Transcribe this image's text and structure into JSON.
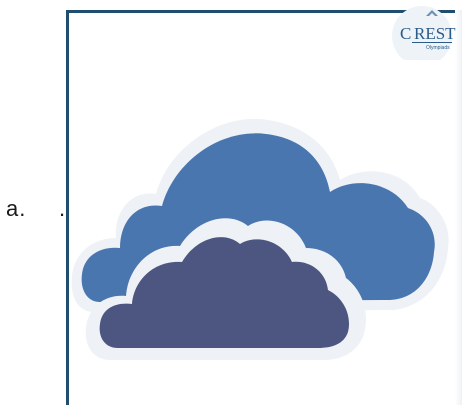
{
  "question": {
    "option_label": "a.",
    "option_marker": "."
  },
  "logo": {
    "text_main": "REST",
    "text_initial": "C",
    "text_sub": "Olympiads"
  },
  "colors": {
    "frame_border": "#1f4e6e",
    "cloud_back": "#4a76b0",
    "cloud_front": "#4d5680",
    "cloud_halo": "#eef2f6",
    "logo_blue": "#2b5b8a"
  },
  "image": {
    "icon": "two-clouds-icon"
  }
}
